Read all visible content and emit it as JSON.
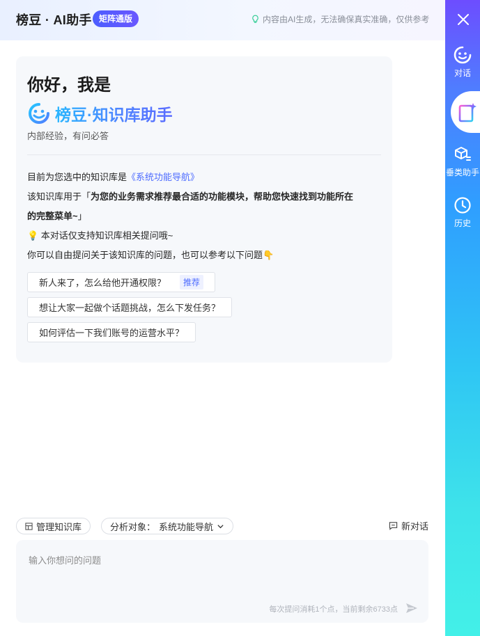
{
  "header": {
    "brand": "榜豆 · AI助手",
    "badge": "矩阵通版",
    "disclaimer": "内容由AI生成，无法确保真实准确，仅供参考"
  },
  "welcome": {
    "greeting": "你好，我是",
    "assistant_name": "榜豆·知识库助手",
    "tagline": "内部经验，有问必答",
    "kb_prefix": "目前为您选中的知识库是",
    "kb_name": "《系统功能导航》",
    "purpose_prefix": "该知识库用于「",
    "purpose_bold_1": "为您的业务需求推荐最合适的功能模块，帮助您快速找到功能所在",
    "purpose_bold_2": "的完整菜单~",
    "purpose_suffix": "」",
    "tip": "💡 本对话仅支持知识库相关提问哦~",
    "hint": "你可以自由提问关于该知识库的问题，也可以参考以下问题👇"
  },
  "suggestions": [
    {
      "text": "新人来了，怎么给他开通权限？",
      "tag": "推荐"
    },
    {
      "text": "想让大家一起做个话题挑战，怎么下发任务？",
      "tag": ""
    },
    {
      "text": "如何评估一下我们账号的运营水平？",
      "tag": ""
    }
  ],
  "toolbar": {
    "manage_kb": "管理知识库",
    "target_label": "分析对象：",
    "target_value": "系统功能导航",
    "new_chat": "新对话"
  },
  "input": {
    "placeholder": "输入你想问的问题",
    "value": "",
    "quota": "每次提问消耗1个点，当前剩余6733点"
  },
  "sidebar": {
    "items": [
      {
        "label": "对话",
        "icon": "smile-chat-icon"
      },
      {
        "label": "",
        "icon": "knowledge-base-icon"
      },
      {
        "label": "垂类助手",
        "icon": "cube-assistant-icon"
      },
      {
        "label": "历史",
        "icon": "clock-history-icon"
      }
    ]
  },
  "colors": {
    "accent": "#4e6cff",
    "badge": "#5a5cff",
    "sidebar_top": "#6d4dff",
    "sidebar_bottom": "#43f0e8"
  }
}
